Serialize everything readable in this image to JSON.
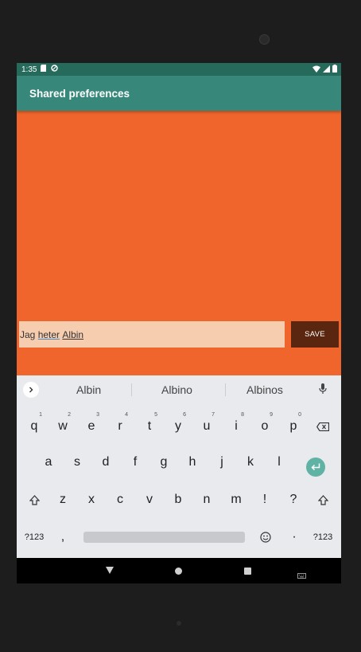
{
  "status_bar": {
    "time": "1:35"
  },
  "app_bar": {
    "title": "Shared preferences"
  },
  "editor": {
    "word1": "Jag",
    "word2": "heter",
    "word3": "Albin"
  },
  "save_button": {
    "label": "SAVE"
  },
  "suggestions": [
    "Albin",
    "Albino",
    "Albinos"
  ],
  "keyboard": {
    "row1": [
      "q",
      "w",
      "e",
      "r",
      "t",
      "y",
      "u",
      "i",
      "o",
      "p"
    ],
    "row1_hints": [
      "1",
      "2",
      "3",
      "4",
      "5",
      "6",
      "7",
      "8",
      "9",
      "0"
    ],
    "row2": [
      "a",
      "s",
      "d",
      "f",
      "g",
      "h",
      "j",
      "k",
      "l"
    ],
    "row3": [
      "z",
      "x",
      "c",
      "v",
      "b",
      "n",
      "m",
      "!",
      "?"
    ],
    "row4": {
      "sym_left": "?123",
      "comma": ",",
      "period": "·",
      "sym_right": "?123"
    }
  },
  "colors": {
    "status_bar": "#266a5c",
    "app_bar": "#37887a",
    "content": "#ef652c",
    "edit_field": "#f7cdb0",
    "save_button": "#5b2610"
  }
}
